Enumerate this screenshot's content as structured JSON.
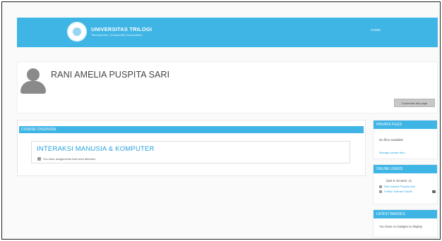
{
  "navbar": {
    "brand_name": "UNIVERSITAS TRILOGI",
    "brand_tagline": "Teknopreneur | Kolaboratif | Kemandirian",
    "home_link": "HOME",
    "accent_color": "#3fb5e6"
  },
  "profile": {
    "name": "RANI AMELIA PUSPITA SARI",
    "customize_button": "Customise this page"
  },
  "course_overview": {
    "header": "COURSE OVERVIEW",
    "course_title": "INTERAKSI MANUSIA & KOMPUTER",
    "assignment_notice": "You have assignments that need attention"
  },
  "sidebar": {
    "private_files": {
      "header": "PRIVATE FILES",
      "empty_text": "No files available",
      "manage_link": "Manage private files..."
    },
    "online_users": {
      "header": "ONLINE USERS",
      "timeframe": "(last 5 minutes: 2)",
      "users": [
        "Rani Amelia Puspita Sari",
        "Fathan Salman Fauzik"
      ]
    },
    "latest_badges": {
      "header": "LATEST BADGES",
      "empty_text": "You have no badges to display"
    }
  }
}
